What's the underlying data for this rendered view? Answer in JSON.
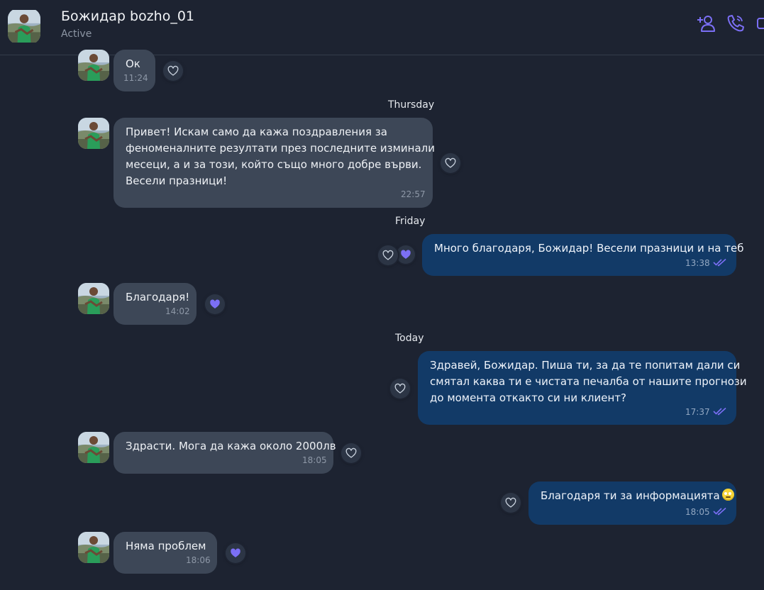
{
  "header": {
    "name": "Божидар bozho_01",
    "status": "Active",
    "icons": [
      "add-contact-icon",
      "phone-icon",
      "video-icon"
    ],
    "accent_color": "#7b6ff5"
  },
  "days": {
    "thursday": "Thursday",
    "friday": "Friday",
    "today": "Today"
  },
  "messages": [
    {
      "dir": "in",
      "text": "Ок",
      "time": "11:24",
      "reaction": "empty"
    },
    {
      "dir": "in",
      "lines": [
        "Привет! Искам само да кажа поздравления за",
        "феноменалните резултати през последните изминали",
        "месеци, а и за този, който също много добре върви.",
        "Весели празници!"
      ],
      "time": "22:57",
      "reaction": "empty"
    },
    {
      "dir": "out",
      "text": "Много благодаря, Божидар! Весели празници и на теб",
      "time": "13:38",
      "reaction": "liked"
    },
    {
      "dir": "in",
      "text": "Благодаря!",
      "time": "14:02",
      "reaction": "liked"
    },
    {
      "dir": "out",
      "lines": [
        "Здравей, Божидар. Пиша ти, за да те попитам дали си",
        "смятал каква ти е чистата печалба от нашите прогнози",
        "до момента откакто си ни клиент?"
      ],
      "time": "17:37",
      "reaction": "empty"
    },
    {
      "dir": "in",
      "text": "Здрасти. Мога да кажа около 2000лв",
      "time": "18:05",
      "reaction": "empty"
    },
    {
      "dir": "out",
      "text": "Благодаря ти за информацията",
      "emoji": "smile-emoji",
      "time": "18:05",
      "reaction": "empty"
    },
    {
      "dir": "in",
      "text": "Няма проблем",
      "time": "18:06",
      "reaction": "liked"
    }
  ]
}
